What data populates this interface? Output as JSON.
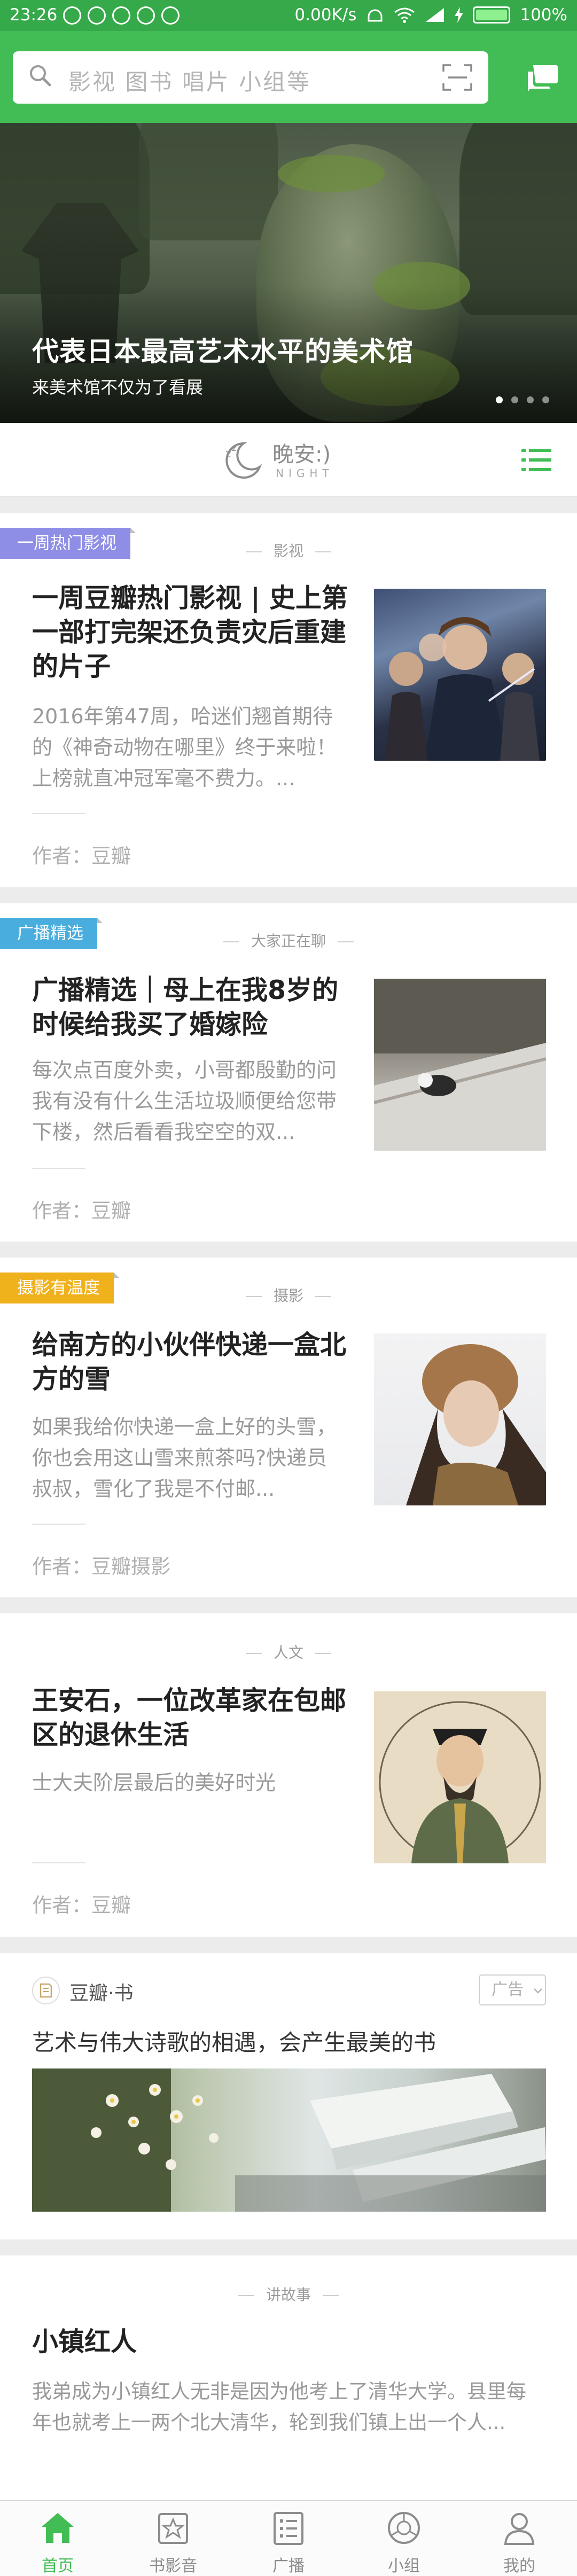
{
  "status_bar": {
    "time": "23:26",
    "speed": "0.00K/s",
    "battery": "100%"
  },
  "search": {
    "placeholder": "影视 图书 唱片 小组等"
  },
  "banner": {
    "title": "代表日本最高艺术水平的美术馆",
    "subtitle": "来美术馆不仅为了看展",
    "dots": 4,
    "active_dot": 1
  },
  "night": {
    "title": "晚安:)",
    "subtitle": "NIGHT"
  },
  "feed": [
    {
      "tag": "一周热门影视",
      "tag_color": "#8f8ee6",
      "category": "影视",
      "title": "一周豆瓣热门影视 | 史上第一部打完架还负责灾后重建的片子",
      "desc": "2016年第47周，哈迷们翘首期待的《神奇动物在哪里》终于来啦！上榜就直冲冠军毫不费力。...",
      "author": "作者：豆瓣"
    },
    {
      "tag": "广播精选",
      "tag_color": "#49aede",
      "category": "大家正在聊",
      "title": "广播精选｜母上在我8岁的时候给我买了婚嫁险",
      "desc": "每次点百度外卖，小哥都殷勤的问我有没有什么生活垃圾顺便给您带下楼，然后看看我空空的双...",
      "author": "作者：豆瓣"
    },
    {
      "tag": "摄影有温度",
      "tag_color": "#f0b21c",
      "category": "摄影",
      "title": "给南方的小伙伴快递一盒北方的雪",
      "desc": "如果我给你快递一盒上好的头雪，你也会用这山雪来煎茶吗?快递员叔叔，雪化了我是不付邮...",
      "author": "作者：豆瓣摄影"
    },
    {
      "category": "人文",
      "title": "王安石，一位改革家在包邮区的退休生活",
      "desc": "士大夫阶层最后的美好时光",
      "author": "作者：豆瓣"
    }
  ],
  "ad": {
    "brand": "豆瓣·书",
    "badge": "广告",
    "text": "艺术与伟大诗歌的相遇，会产生最美的书"
  },
  "story": {
    "category": "讲故事",
    "title": "小镇红人",
    "desc": "我弟成为小镇红人无非是因为他考上了清华大学。县里每年也就考上一两个北大清华，轮到我们镇上出一个人..."
  },
  "tabs": [
    {
      "label": "首页",
      "icon": "home-icon",
      "active": true
    },
    {
      "label": "书影音",
      "icon": "star-card-icon",
      "active": false
    },
    {
      "label": "广播",
      "icon": "broadcast-icon",
      "active": false
    },
    {
      "label": "小组",
      "icon": "group-icon",
      "active": false
    },
    {
      "label": "我的",
      "icon": "person-icon",
      "active": false
    }
  ],
  "colors": {
    "brand_green": "#42bd56"
  }
}
